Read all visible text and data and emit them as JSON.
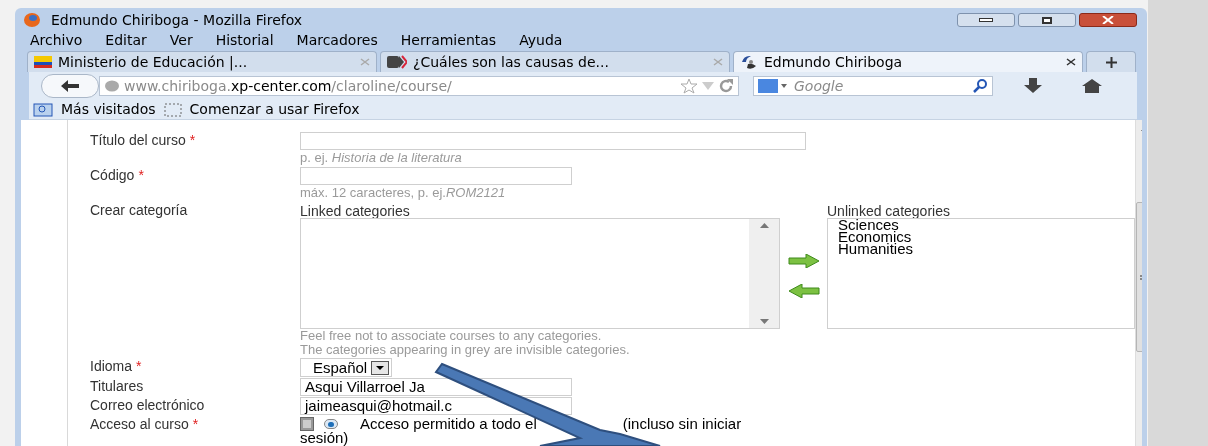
{
  "window": {
    "title": "Edmundo Chiriboga - Mozilla Firefox"
  },
  "menu": [
    "Archivo",
    "Editar",
    "Ver",
    "Historial",
    "Marcadores",
    "Herramientas",
    "Ayuda"
  ],
  "tabs": [
    {
      "label": "Ministerio de Educación |...",
      "selected": false,
      "kind": "flag"
    },
    {
      "label": "¿Cuáles son las causas de...",
      "selected": false,
      "kind": "media"
    },
    {
      "label": "Edmundo Chiriboga",
      "selected": true,
      "kind": "site"
    }
  ],
  "address": {
    "prefix": "www.chiriboga.",
    "domain": "xp-center.com",
    "path": "/claroline/course/"
  },
  "search": {
    "placeholder": "Google"
  },
  "bookmarks": [
    "Más visitados",
    "Comenzar a usar Firefox"
  ],
  "form": [
    {
      "kind": "text",
      "label": "Título del curso",
      "required_mark": "*",
      "hint": "p. ej. *Historia de la literatura*"
    },
    {
      "kind": "code",
      "label": "Código",
      "required_mark": "*",
      "hint": "máx. 12 caracteres, p. ej.*ROM2121*"
    },
    {
      "kind": "categories",
      "label": "Crear categoría",
      "linked_label": "Linked categories",
      "unlinked_label": "Unlinked categories",
      "unlinked_items": [
        "Sciences",
        "Economics",
        "Humanities"
      ],
      "notes": [
        "Feel free not to associate courses to any categories.",
        "The categories appearing in grey are invisible categories."
      ]
    },
    {
      "kind": "select",
      "label": "Idioma",
      "required_mark": "*",
      "value": "Español"
    },
    {
      "kind": "text",
      "label": "Titulares",
      "value": "Asqui Villarroel Ja"
    },
    {
      "kind": "text",
      "label": "Correo electrónico",
      "value": "jaimeasqui@hotmail.c"
    },
    {
      "kind": "access",
      "label": "Acceso al curso",
      "required_mark": "*",
      "selected": true,
      "option_parts": [
        "Acceso permitido a todo el",
        "(incluso sin iniciar"
      ],
      "option_tail": "sesión)"
    }
  ]
}
